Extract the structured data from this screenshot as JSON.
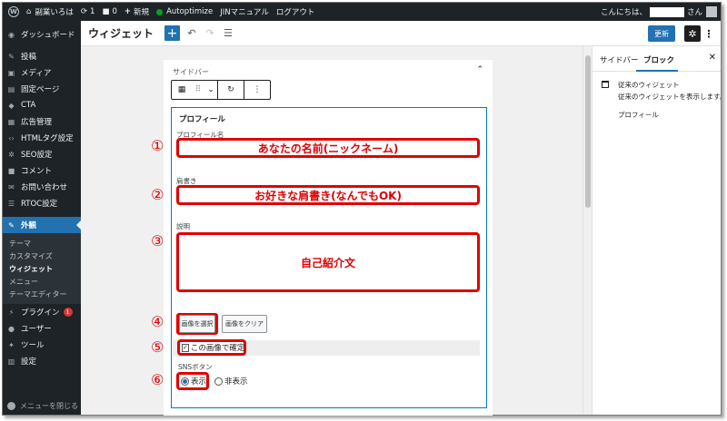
{
  "admin_bar": {
    "site_name": "副業いろは",
    "updates_count": "1",
    "comments_count": "0",
    "new_label": "新規",
    "plugin_label": "Autoptimize",
    "manual_label": "JINマニュアル",
    "logout_label": "ログアウト",
    "greeting_prefix": "こんにちは、",
    "greeting_suffix": "さん"
  },
  "sidebar": {
    "items": [
      {
        "label": "ダッシュボード",
        "icon": "dashboard-icon"
      },
      {
        "label": "投稿",
        "icon": "pin-icon"
      },
      {
        "label": "メディア",
        "icon": "media-icon"
      },
      {
        "label": "固定ページ",
        "icon": "page-icon"
      },
      {
        "label": "CTA",
        "icon": "tag-icon"
      },
      {
        "label": "広告管理",
        "icon": "ad-icon"
      },
      {
        "label": "HTMLタグ設定",
        "icon": "code-icon"
      },
      {
        "label": "SEO設定",
        "icon": "gear-icon"
      },
      {
        "label": "コメント",
        "icon": "comment-icon"
      },
      {
        "label": "お問い合わせ",
        "icon": "mail-icon"
      },
      {
        "label": "RTOC設定",
        "icon": "list-icon"
      }
    ],
    "active_item": {
      "label": "外観",
      "icon": "brush-icon"
    },
    "submenu": [
      "テーマ",
      "カスタマイズ",
      "ウィジェット",
      "メニュー",
      "テーマエディター"
    ],
    "lower_items": [
      {
        "label": "プラグイン",
        "icon": "plugin-icon",
        "badge": "1"
      },
      {
        "label": "ユーザー",
        "icon": "user-icon"
      },
      {
        "label": "ツール",
        "icon": "wrench-icon"
      },
      {
        "label": "設定",
        "icon": "settings-icon"
      }
    ],
    "collapse_label": "メニューを閉じる"
  },
  "header": {
    "title": "ウィジェット",
    "update_label": "更新"
  },
  "widget_area": {
    "title": "サイドバー"
  },
  "block": {
    "title": "プロフィール",
    "name_label": "プロフィール名",
    "name_value": "あなたの名前(ニックネーム)",
    "tagline_label": "肩書き",
    "tagline_value": "お好きな肩書き(なんでもOK)",
    "desc_label": "説明",
    "desc_value": "自己紹介文",
    "select_image_label": "画像を選択",
    "clear_image_label": "画像をクリア",
    "confirm_label": "この画像で確定",
    "sns_label": "SNSボタン",
    "show_label": "表示",
    "hide_label": "非表示"
  },
  "annotations": [
    "①",
    "②",
    "③",
    "④",
    "⑤",
    "⑥"
  ],
  "panel": {
    "tab_sidebar": "サイドバー",
    "tab_block": "ブロック",
    "block_name": "従来のウィジェット",
    "block_desc": "従来のウィジェットを表示します。",
    "widget_item": "プロフィール"
  },
  "colors": {
    "admin_dark": "#1d2327",
    "accent_blue": "#2271b1",
    "annotation_red": "#e00000"
  }
}
